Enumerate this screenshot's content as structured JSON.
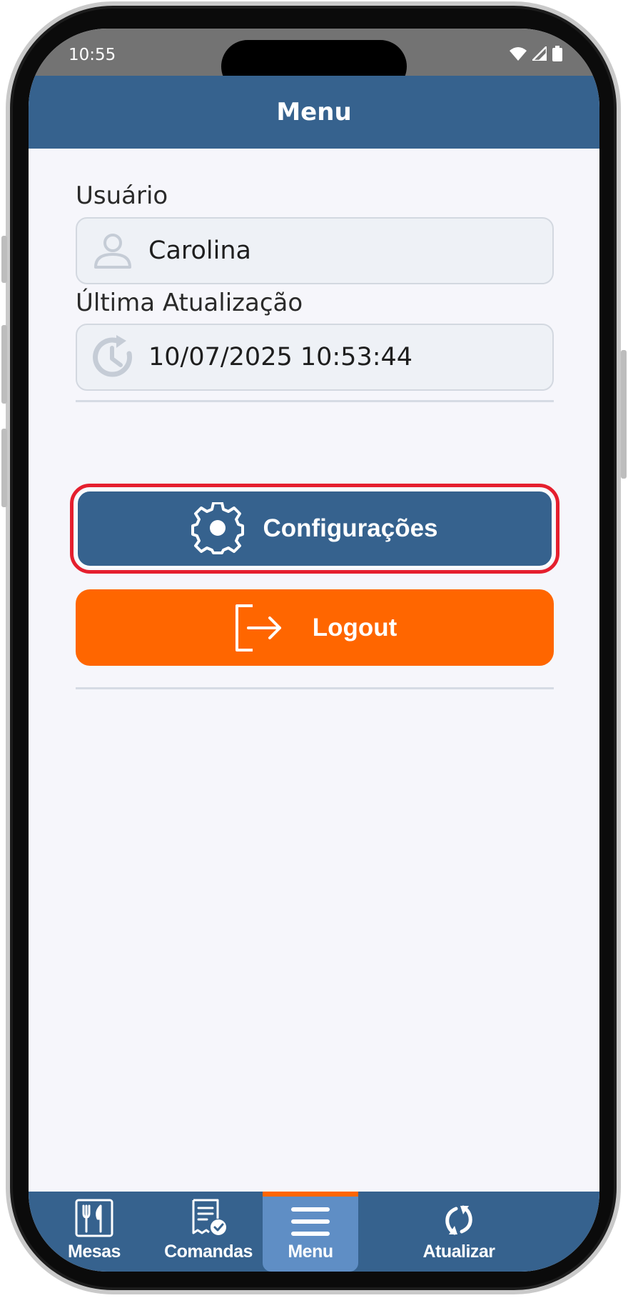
{
  "status_bar": {
    "time": "10:55"
  },
  "header": {
    "title": "Menu"
  },
  "user": {
    "label": "Usuário",
    "value": "Carolina"
  },
  "last_update": {
    "label": "Última Atualização",
    "value": "10/07/2025 10:53:44"
  },
  "actions": {
    "config_label": "Configurações",
    "logout_label": "Logout"
  },
  "nav": {
    "items": [
      {
        "label": "Mesas",
        "icon": "utensils-icon"
      },
      {
        "label": "Comandas",
        "icon": "receipt-check-icon"
      },
      {
        "label": "Menu",
        "icon": "hamburger-menu-icon",
        "active": true
      },
      {
        "label": "Atualizar",
        "icon": "refresh-icon"
      }
    ]
  },
  "colors": {
    "primary": "#36628e",
    "accent": "#ff6600",
    "highlight": "#e51f2e",
    "nav_active": "#5f8ec5"
  }
}
